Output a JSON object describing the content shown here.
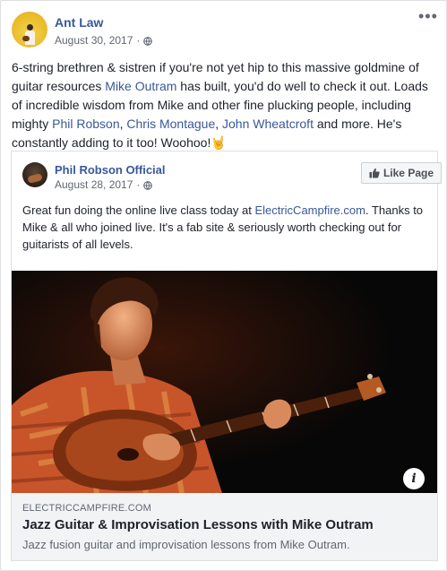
{
  "post": {
    "author": "Ant Law",
    "date": "August 30, 2017",
    "separator": "·",
    "text_parts": {
      "p1": "6-string brethren & sistren if you're not yet hip to this massive goldmine of guitar resources ",
      "link_mike": "Mike Outram",
      "p2": " has built, you'd do well to check it out. Loads of incredible wisdom from Mike and other fine plucking people, including mighty ",
      "link_phil": "Phil Robson",
      "comma1": ", ",
      "link_chris": "Chris Montague",
      "comma2": ", ",
      "link_john": "John Wheatcroft",
      "p3": " and more. He's constantly adding to it too! Woohoo!",
      "emoji": "🤘"
    }
  },
  "shared": {
    "page_name": "Phil Robson Official",
    "date": "August 28, 2017",
    "separator": "·",
    "like_label": "Like Page",
    "text_parts": {
      "p1": "Great fun doing the online live class today at ",
      "link": "ElectricCampfire.com",
      "p2": ". Thanks to Mike & all who joined live. It's a fab site & seriously worth checking out for guitarists of all levels."
    },
    "info_label": "i",
    "link_preview": {
      "domain": "ELECTRICCAMPFIRE.COM",
      "title": "Jazz Guitar & Improvisation Lessons with Mike Outram",
      "description": "Jazz fusion guitar and improvisation lessons from Mike Outram."
    }
  },
  "icons": {
    "more": "more-horizontal-icon",
    "globe": "globe-icon",
    "thumb": "thumbs-up-icon",
    "info": "info-icon"
  },
  "colors": {
    "link": "#385898",
    "text": "#1d2129",
    "meta": "#606770",
    "footer_bg": "#f2f3f5"
  }
}
